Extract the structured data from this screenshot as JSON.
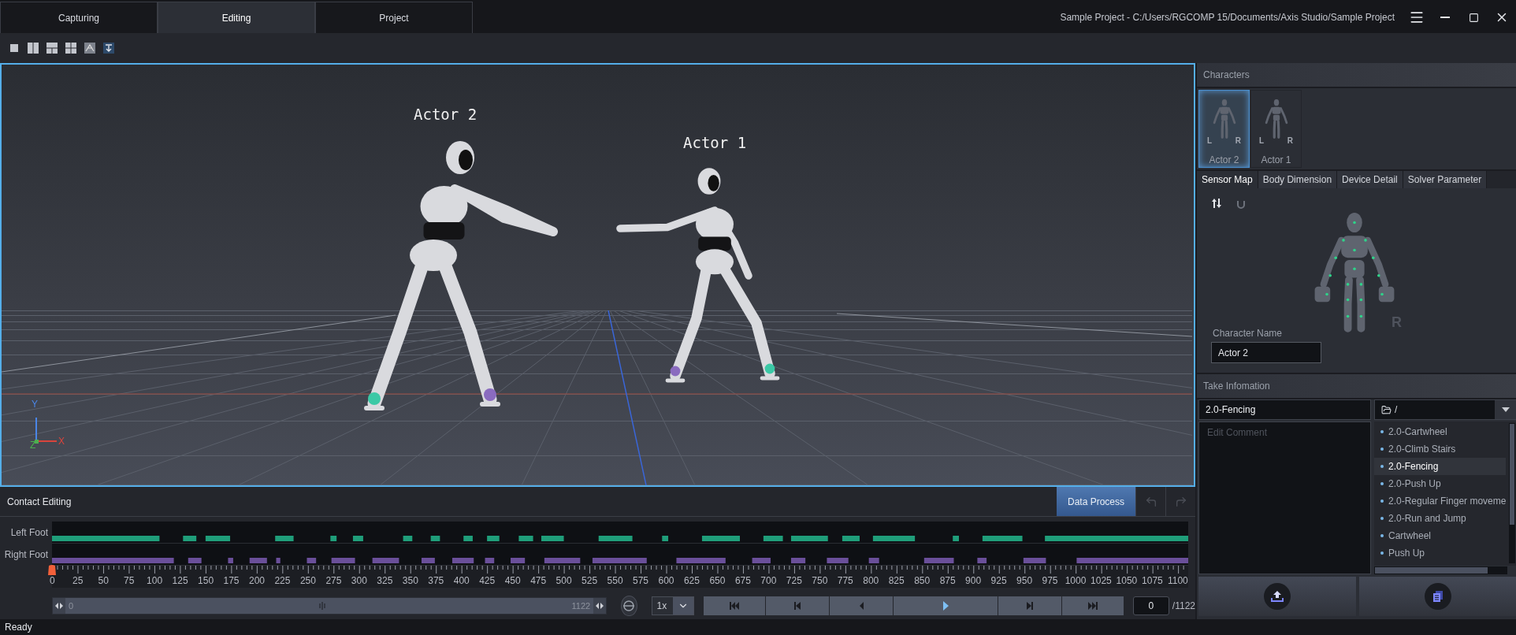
{
  "window": {
    "title": "Sample Project - C:/Users/RGCOMP 15/Documents/Axis Studio/Sample Project"
  },
  "mode_tabs": [
    {
      "label": "Capturing",
      "selected": false
    },
    {
      "label": "Editing",
      "selected": true
    },
    {
      "label": "Project",
      "selected": false
    }
  ],
  "viewport": {
    "actor_labels": [
      {
        "label": "Actor 2"
      },
      {
        "label": "Actor 1"
      }
    ],
    "axes": {
      "y": "Y",
      "z": "Z",
      "x": "X"
    }
  },
  "contact_editing": {
    "title": "Contact Editing",
    "data_process": "Data Process",
    "tracks": [
      {
        "label": "Left Foot",
        "kind": "left"
      },
      {
        "label": "Right Foot",
        "kind": "right"
      }
    ],
    "ruler_labels": [
      "0",
      "25",
      "50",
      "75",
      "100",
      "125",
      "150",
      "175",
      "200",
      "225",
      "250",
      "275",
      "300",
      "325",
      "350",
      "375",
      "400",
      "425",
      "450",
      "475",
      "500",
      "525",
      "550",
      "575",
      "600",
      "625",
      "650",
      "675",
      "700",
      "725",
      "750",
      "775",
      "800",
      "825",
      "850",
      "875",
      "900",
      "925",
      "950",
      "975",
      "1000",
      "1025",
      "1050",
      "1075",
      "1100"
    ],
    "scroll_start": "0",
    "scroll_end": "1122",
    "speed": "1x",
    "frame": "0",
    "frame_total": "/1122"
  },
  "characters": {
    "title": "Characters",
    "cards": [
      {
        "name": "Actor 2",
        "selected": true,
        "left_mark": "L",
        "right_mark": "R"
      },
      {
        "name": "Actor 1",
        "selected": false,
        "left_mark": "L",
        "right_mark": "R"
      }
    ]
  },
  "detail_tabs": [
    {
      "label": "Sensor Map",
      "selected": true
    },
    {
      "label": "Body Dimension",
      "selected": false
    },
    {
      "label": "Device Detail",
      "selected": false
    },
    {
      "label": "Solver Parameter",
      "selected": false
    }
  ],
  "sensor_map": {
    "side_label": "R",
    "name_label": "Character Name",
    "name_value": "Actor 2"
  },
  "take_information": {
    "title": "Take Infomation",
    "take_name": "2.0-Fencing",
    "comment_placeholder": "Edit Comment",
    "folder": "/",
    "takes": [
      {
        "label": "2.0-Cartwheel",
        "selected": false
      },
      {
        "label": "2.0-Climb Stairs",
        "selected": false
      },
      {
        "label": "2.0-Fencing",
        "selected": true
      },
      {
        "label": "2.0-Push Up",
        "selected": false
      },
      {
        "label": "2.0-Regular Finger moveme",
        "selected": false
      },
      {
        "label": "2.0-Run and Jump",
        "selected": false
      },
      {
        "label": "Cartwheel",
        "selected": false
      },
      {
        "label": "Push Up",
        "selected": false
      }
    ]
  },
  "status_bar": {
    "text": "Ready"
  }
}
